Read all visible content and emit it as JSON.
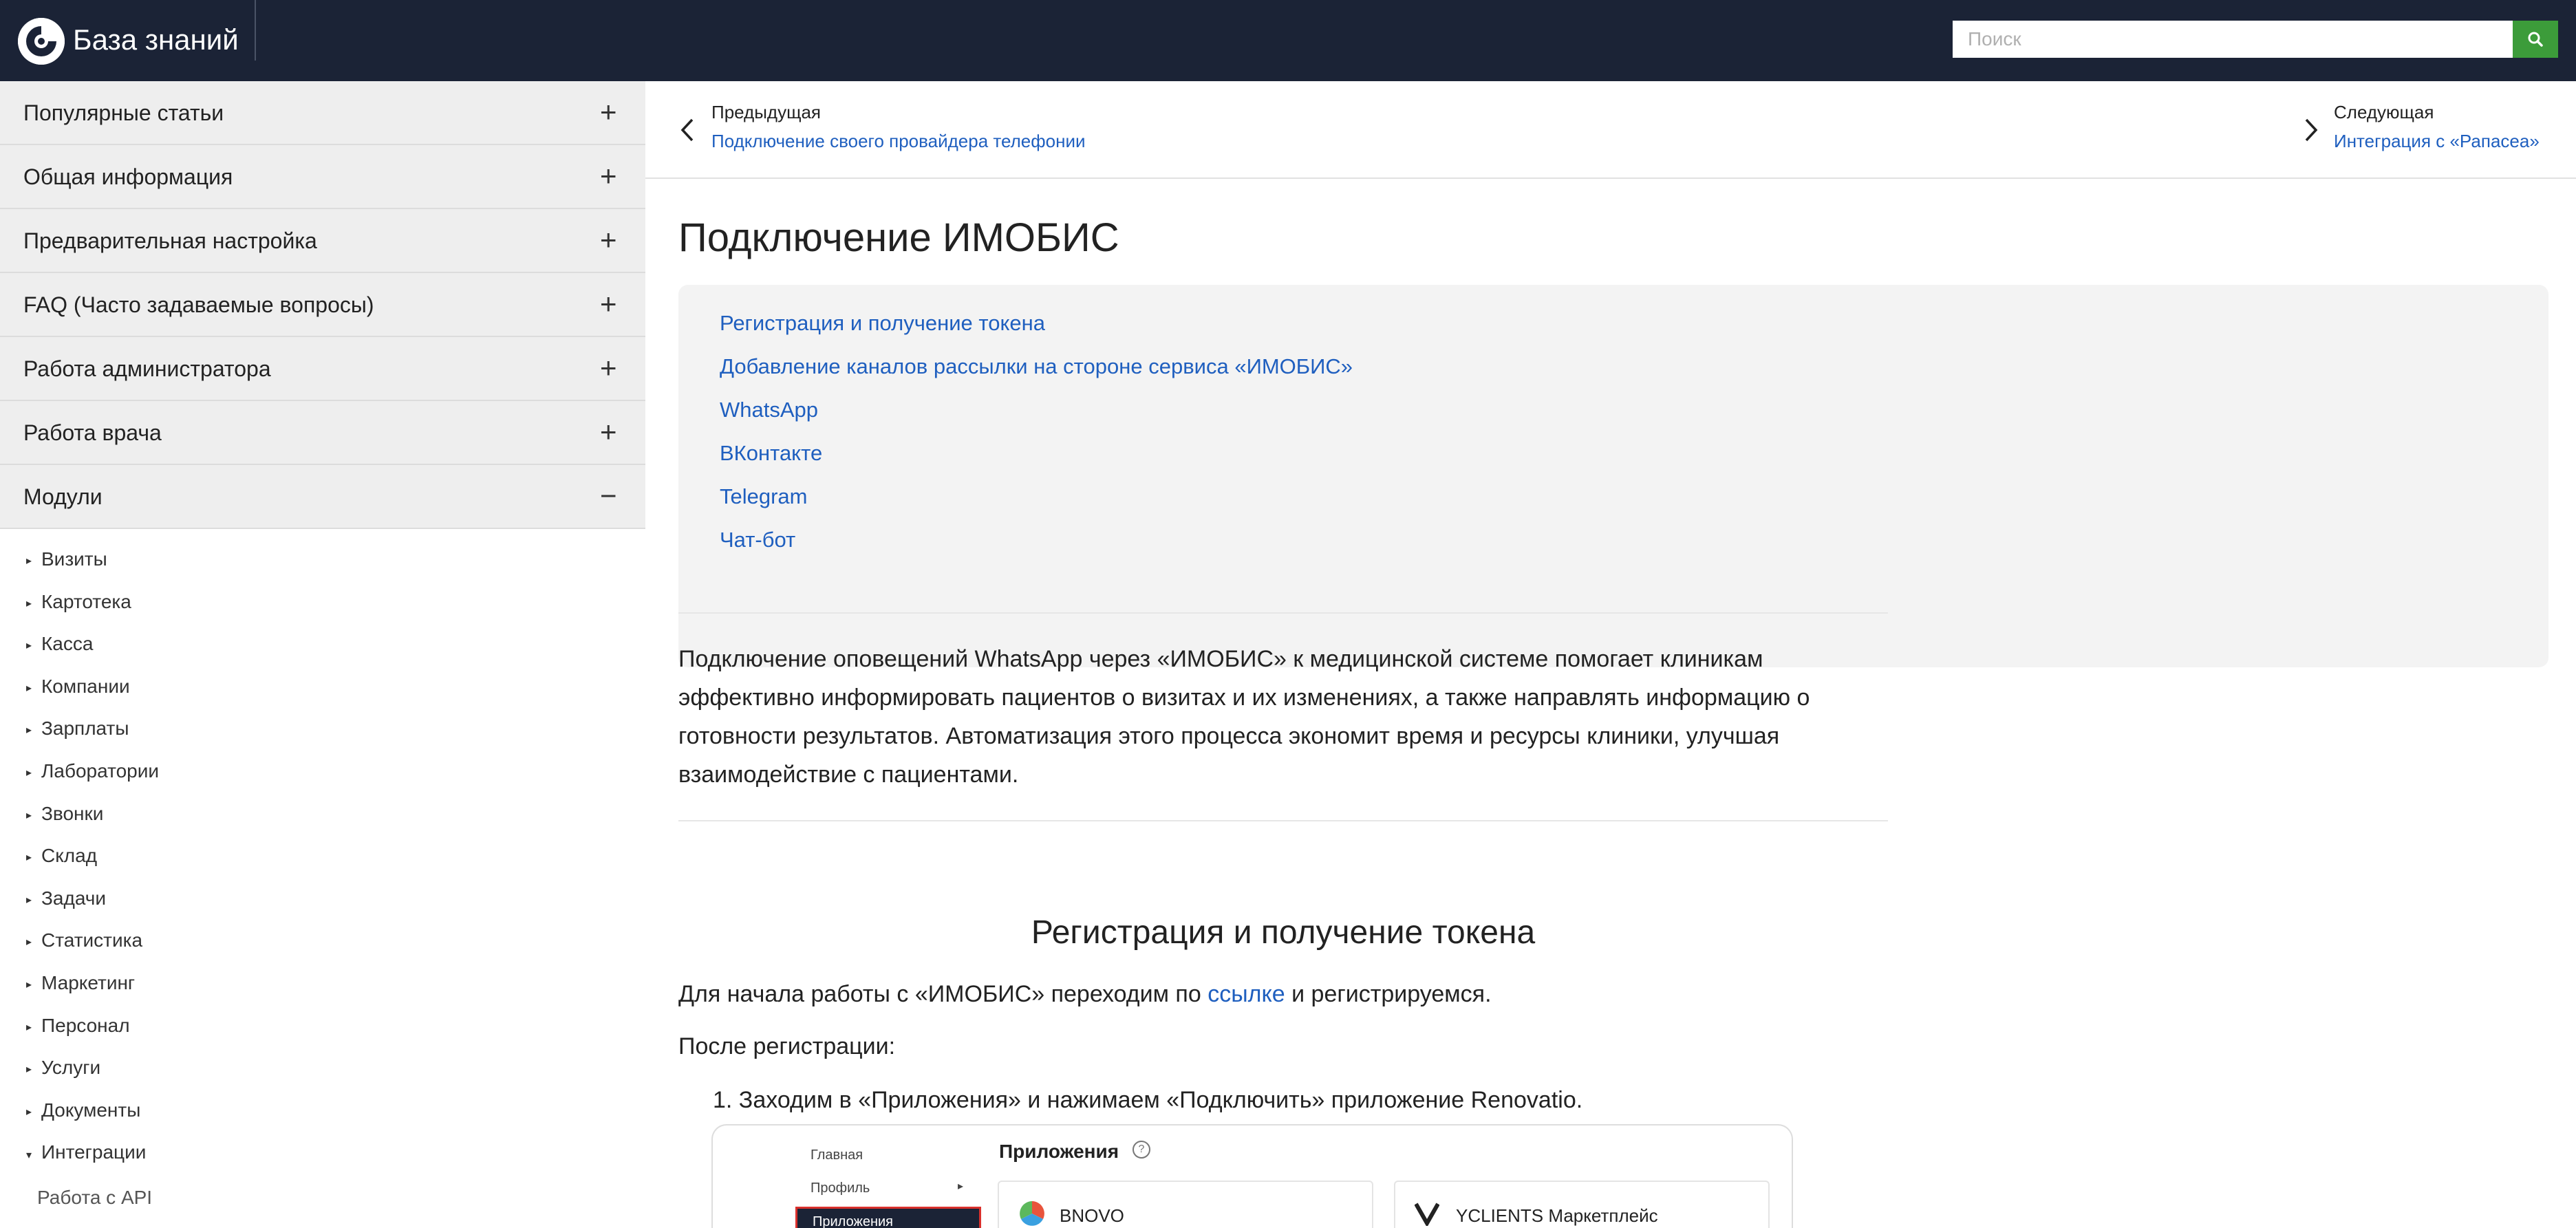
{
  "header": {
    "brand": "База знаний",
    "search_placeholder": "Поиск"
  },
  "sidebar": {
    "sections": [
      {
        "label": "Популярные статьи",
        "toggle": "+"
      },
      {
        "label": "Общая информация",
        "toggle": "+"
      },
      {
        "label": "Предварительная настройка",
        "toggle": "+"
      },
      {
        "label": "FAQ (Часто задаваемые вопросы)",
        "toggle": "+"
      },
      {
        "label": "Работа администратора",
        "toggle": "+"
      },
      {
        "label": "Работа врача",
        "toggle": "+"
      },
      {
        "label": "Модули",
        "toggle": "−"
      }
    ],
    "modules": [
      "Визиты",
      "Картотека",
      "Касса",
      "Компании",
      "Зарплаты",
      "Лаборатории",
      "Звонки",
      "Склад",
      "Задачи",
      "Статистика",
      "Маркетинг",
      "Персонал",
      "Услуги",
      "Документы",
      "Интеграции"
    ],
    "integrations_child": "Работа с API"
  },
  "pager": {
    "prev_caption": "Предыдущая",
    "prev_link": "Подключение своего провайдера телефонии",
    "next_caption": "Следующая",
    "next_link": "Интеграция с «Рапасеа»"
  },
  "article": {
    "title": "Подключение ИМОБИС",
    "toc": [
      "Регистрация и получение токена",
      "Добавление каналов рассылки на стороне сервиса «ИМОБИС»",
      "WhatsApp",
      "ВКонтакте",
      "Telegram",
      "Чат-бот"
    ],
    "intro": "Подключение оповещений WhatsApp через «ИМОБИС» к медицинской системе помогает клиникам эффективно информировать пациентов о визитах и их изменениях, а также направлять информацию о готовности результатов. Автоматизация этого процесса экономит время и ресурсы клиники, улучшая взаимодействие с пациентами.",
    "section_title": "Регистрация и получение токена",
    "para1_before": "Для начала работы с «ИМОБИС» переходим по ",
    "para1_link": "ссылке",
    "para1_after": " и регистрируемся.",
    "para2": "После регистрации:",
    "step1": "1. Заходим в «Приложения» и нажимаем «Подключить» приложение Renovatio."
  },
  "screenshot": {
    "menu_main": "Главная",
    "menu_profile": "Профиль",
    "menu_apps": "Приложения",
    "apps_heading": "Приложения",
    "card1": "BNOVO",
    "card2": "YCLIENTS Маркетплейс"
  },
  "colors": {
    "topbar": "#1b2336",
    "link": "#1f5fbf",
    "search_button": "#3c9c3a"
  }
}
